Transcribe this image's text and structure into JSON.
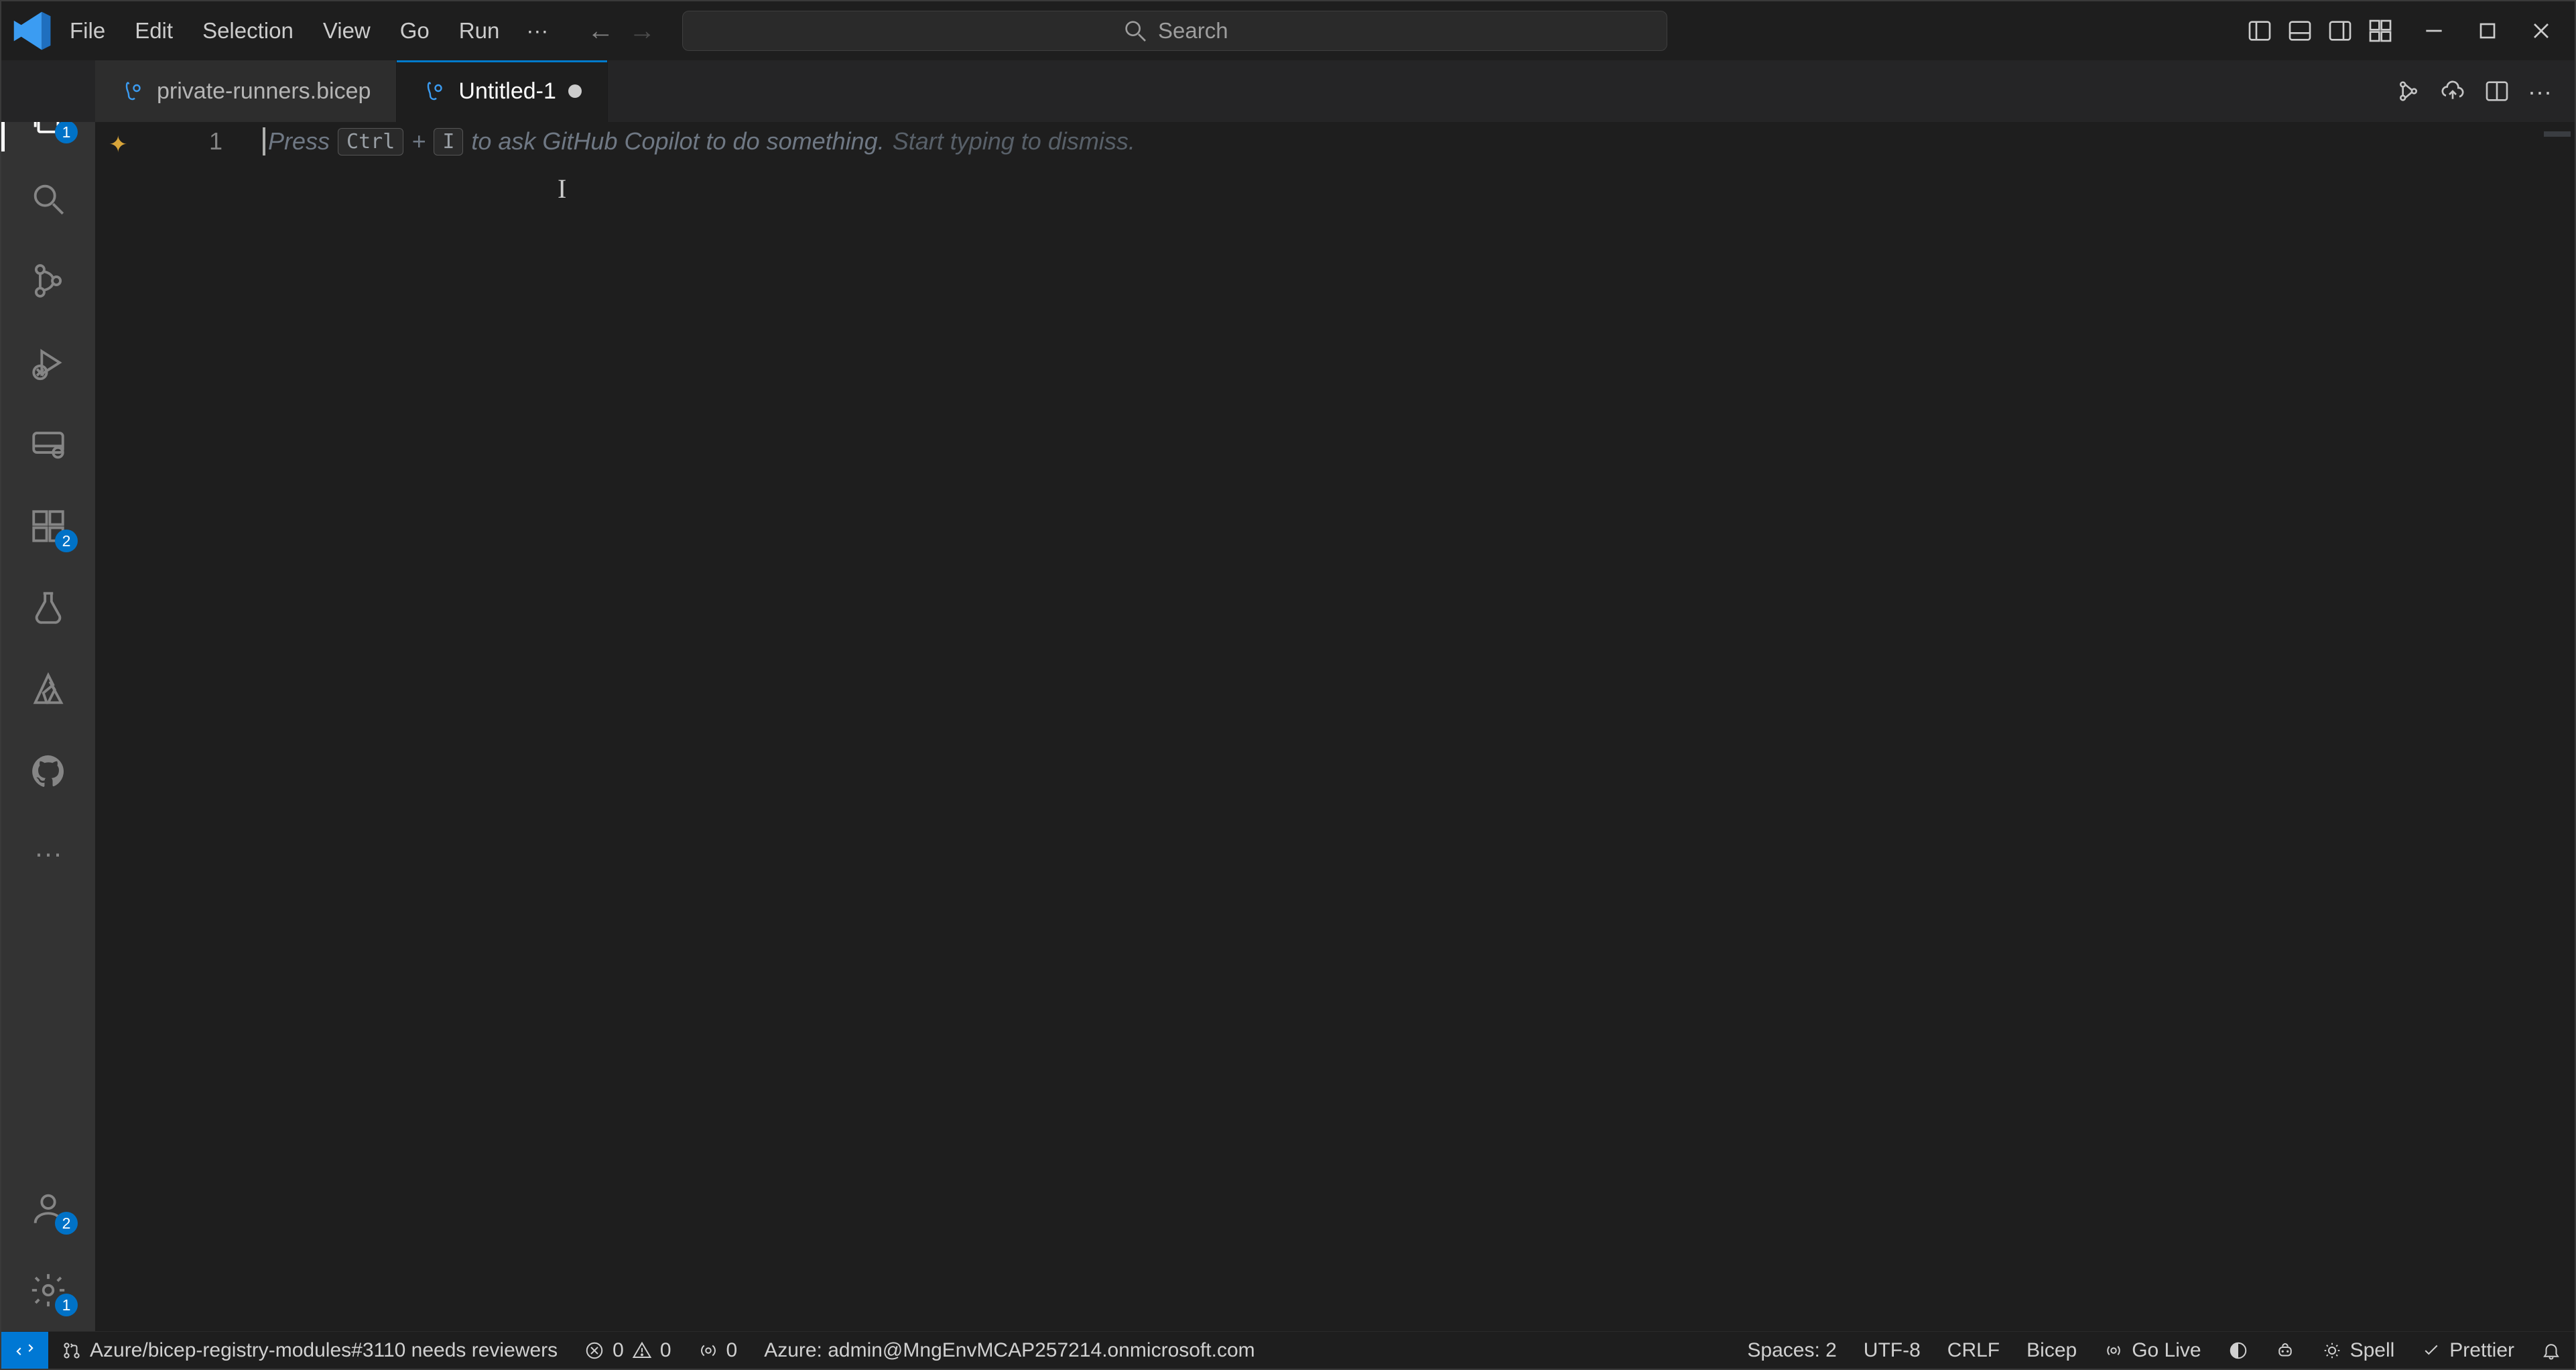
{
  "menu": {
    "file": "File",
    "edit": "Edit",
    "selection": "Selection",
    "view": "View",
    "go": "Go",
    "run": "Run"
  },
  "search": {
    "placeholder": "Search"
  },
  "tabs": [
    {
      "label": "private-runners.bicep",
      "active": false,
      "dirty": false
    },
    {
      "label": "Untitled-1",
      "active": true,
      "dirty": true
    }
  ],
  "activity": {
    "explorer_badge": "1",
    "extensions_badge": "2",
    "accounts_badge": "2",
    "settings_badge": "1"
  },
  "editor": {
    "line_number": "1",
    "ghost_prefix": "Press",
    "ghost_kbd1": "Ctrl",
    "ghost_plus": "+",
    "ghost_kbd2": "I",
    "ghost_mid": "to ask GitHub Copilot to do something.",
    "ghost_suffix": "Start typing to dismiss."
  },
  "status": {
    "pr": "Azure/bicep-registry-modules#3110 needs reviewers",
    "errors": "0",
    "warnings": "0",
    "ports": "0",
    "azure": "Azure: admin@MngEnvMCAP257214.onmicrosoft.com",
    "spaces": "Spaces: 2",
    "encoding": "UTF-8",
    "eol": "CRLF",
    "language": "Bicep",
    "golive": "Go Live",
    "spell": "Spell",
    "prettier": "Prettier"
  }
}
